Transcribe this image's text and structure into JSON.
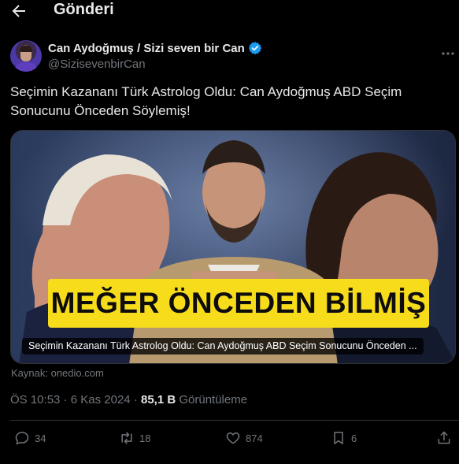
{
  "header": {
    "title": "Gönderi"
  },
  "author": {
    "display_name": "Can Aydoğmuş / Sizi seven bir Can",
    "handle": "@SizisevenbirCan",
    "verified": true
  },
  "tweet": {
    "text": "Seçimin Kazananı Türk Astrolog Oldu: Can Aydoğmuş ABD Seçim Sonucunu Önceden Söylemiş!"
  },
  "card": {
    "banner_text": "MEĞER ÖNCEDEN BİLMİŞ",
    "caption": "Seçimin Kazananı Türk Astrolog Oldu: Can Aydoğmuş ABD Seçim Sonucunu Önceden ...",
    "source": "Kaynak: onedio.com"
  },
  "meta": {
    "time": "ÖS 10:53",
    "separator": "·",
    "date": "6 Kas 2024",
    "views_count": "85,1 B",
    "views_label": "Görüntüleme"
  },
  "actions": {
    "replies": "34",
    "retweets": "18",
    "likes": "874",
    "bookmarks": "6"
  },
  "colors": {
    "background": "#000000",
    "text": "#e7e9ea",
    "muted": "#71767b",
    "verified": "#1d9bf0",
    "banner": "#f7dc1b"
  }
}
